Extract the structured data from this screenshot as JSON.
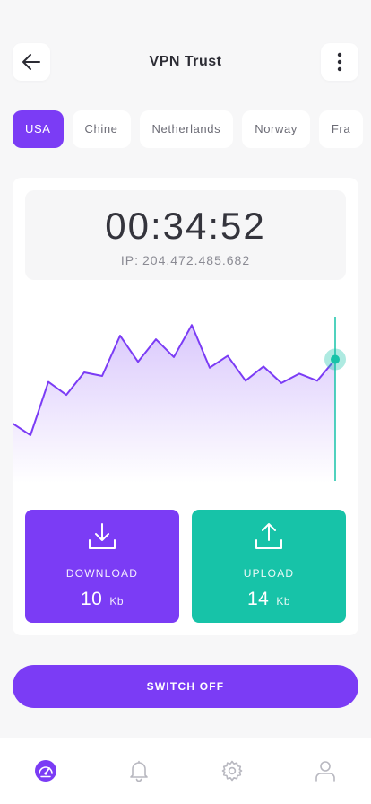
{
  "header": {
    "title": "VPN Trust",
    "back_icon": "arrow-left-icon",
    "menu_icon": "more-vertical-icon"
  },
  "countries": [
    {
      "label": "USA",
      "active": true
    },
    {
      "label": "Chine",
      "active": false
    },
    {
      "label": "Netherlands",
      "active": false
    },
    {
      "label": "Norway",
      "active": false
    },
    {
      "label": "Fra",
      "active": false
    }
  ],
  "session": {
    "timer": "00:34:52",
    "ip_label": "IP:",
    "ip_value": "204.472.485.682"
  },
  "chart_data": {
    "type": "area",
    "title": "",
    "xlabel": "",
    "ylabel": "",
    "values": [
      10,
      0,
      45,
      34,
      53,
      50,
      84,
      62,
      81,
      66,
      93,
      57,
      67,
      46,
      58,
      44,
      52,
      46,
      64
    ],
    "ylim": [
      0,
      100
    ],
    "grid": false,
    "highlight": "last",
    "colors": {
      "line": "#7b3cf5",
      "cursor": "#17c3a8"
    }
  },
  "stats": {
    "download": {
      "label": "DOWNLOAD",
      "value": "10",
      "unit": "Kb",
      "icon": "download-icon"
    },
    "upload": {
      "label": "UPLOAD",
      "value": "14",
      "unit": "Kb",
      "icon": "upload-icon"
    }
  },
  "switch_button": {
    "label": "SWITCH OFF"
  },
  "nav": [
    {
      "icon": "speedometer-icon",
      "active": true
    },
    {
      "icon": "bell-icon",
      "active": false
    },
    {
      "icon": "gear-icon",
      "active": false
    },
    {
      "icon": "user-icon",
      "active": false
    }
  ],
  "colors": {
    "accent": "#7b3cf5",
    "teal": "#17c3a8",
    "background": "#f7f7f8"
  }
}
